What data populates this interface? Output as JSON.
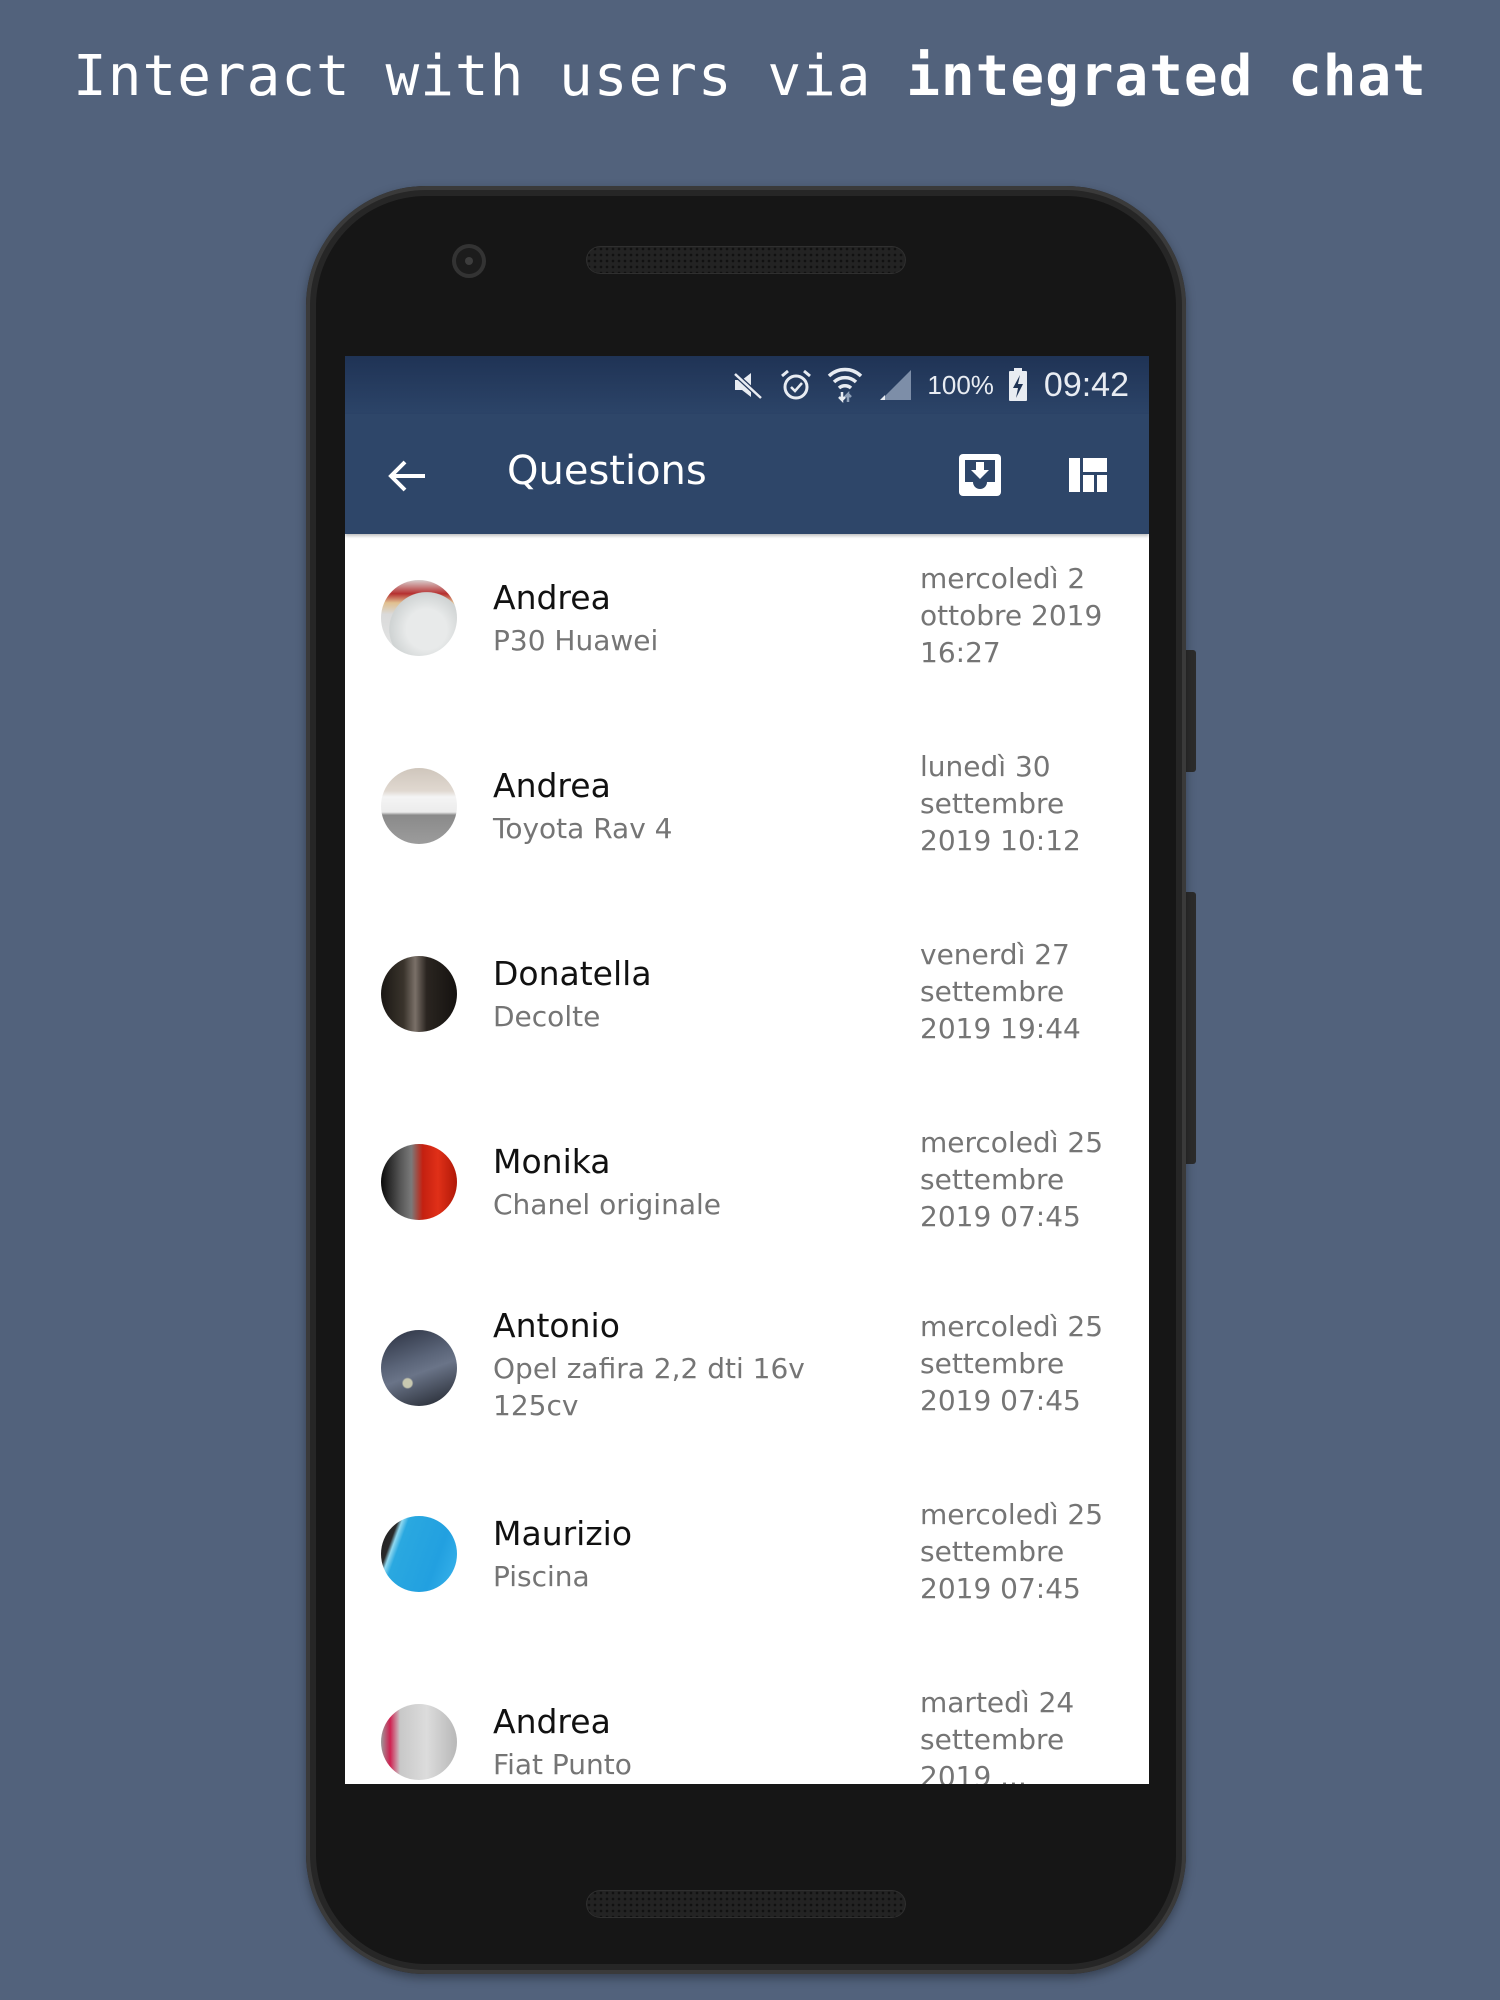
{
  "headline": {
    "normal": "Interact with users via ",
    "bold": "integrated chat"
  },
  "status_bar": {
    "icons": [
      "mute-icon",
      "alarm-icon",
      "wifi-icon",
      "signal-icon",
      "battery-charging-icon"
    ],
    "battery": "100%",
    "time": "09:42"
  },
  "app_bar": {
    "title": "Questions",
    "back_icon": "arrow-left-icon",
    "actions": [
      "inbox-download-icon",
      "dashboard-icon"
    ]
  },
  "colors": {
    "background": "#52627c",
    "app_bar": "#2e4669",
    "status_bar": "#253a5c"
  },
  "conversations": [
    {
      "name": "Andrea",
      "subject": "P30 Huawei",
      "date": "mercoledì 2 ottobre 2019 16:27"
    },
    {
      "name": "Andrea",
      "subject": "Toyota Rav 4",
      "date": "lunedì 30 settembre 2019 10:12"
    },
    {
      "name": "Donatella",
      "subject": "Decolte",
      "date": "venerdì 27 settembre 2019 19:44"
    },
    {
      "name": "Monika",
      "subject": "Chanel originale",
      "date": "mercoledì 25 settembre 2019 07:45"
    },
    {
      "name": "Antonio",
      "subject": "Opel zafira 2,2 dti 16v 125cv",
      "date": "mercoledì 25 settembre 2019 07:45"
    },
    {
      "name": "Maurizio",
      "subject": "Piscina",
      "date": "mercoledì 25 settembre 2019 07:45"
    },
    {
      "name": "Andrea",
      "subject": "Fiat Punto",
      "date": "martedì 24 settembre 2019 ..."
    }
  ]
}
